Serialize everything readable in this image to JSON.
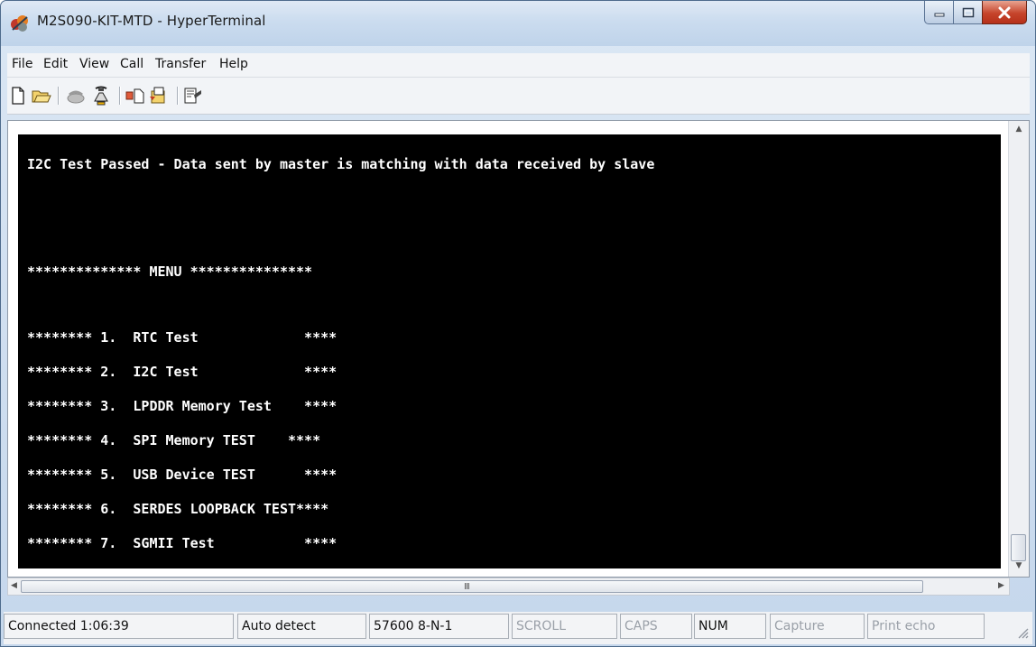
{
  "window": {
    "title": "M2S090-KIT-MTD - HyperTerminal",
    "icon": "hyperterminal-icon",
    "controls": [
      "minimize-icon",
      "maximize-icon",
      "close-icon"
    ],
    "accent": "#c6442b"
  },
  "menu": [
    "File",
    "Edit",
    "View",
    "Call",
    "Transfer",
    "Help"
  ],
  "toolbar": [
    "new-icon",
    "open-icon",
    "connect-icon",
    "disconnect-icon",
    "send-icon",
    "receive-icon",
    "properties-icon"
  ],
  "terminal": {
    "background": "#000000",
    "foreground": "#ffffff",
    "lines": [
      "I2C Test Passed - Data sent by master is matching with data received by slave",
      "",
      "",
      "************** MENU ***************",
      "",
      "******** 1.  RTC Test             ****",
      "******** 2.  I2C Test             ****",
      "******** 3.  LPDDR Memory Test    ****",
      "******** 4.  SPI Memory TEST    ****",
      "******** 5.  USB Device TEST      ****",
      "******** 6.  SERDES LOOPBACK TEST****",
      "******** 7.  SGMII Test           ****"
    ]
  },
  "scroll": {
    "h_grip": "III"
  },
  "status": {
    "connected": "Connected 1:06:39",
    "detect": "Auto detect",
    "settings": "57600 8-N-1",
    "scroll": "SCROLL",
    "caps": "CAPS",
    "num": "NUM",
    "capture": "Capture",
    "print_echo": "Print echo"
  }
}
